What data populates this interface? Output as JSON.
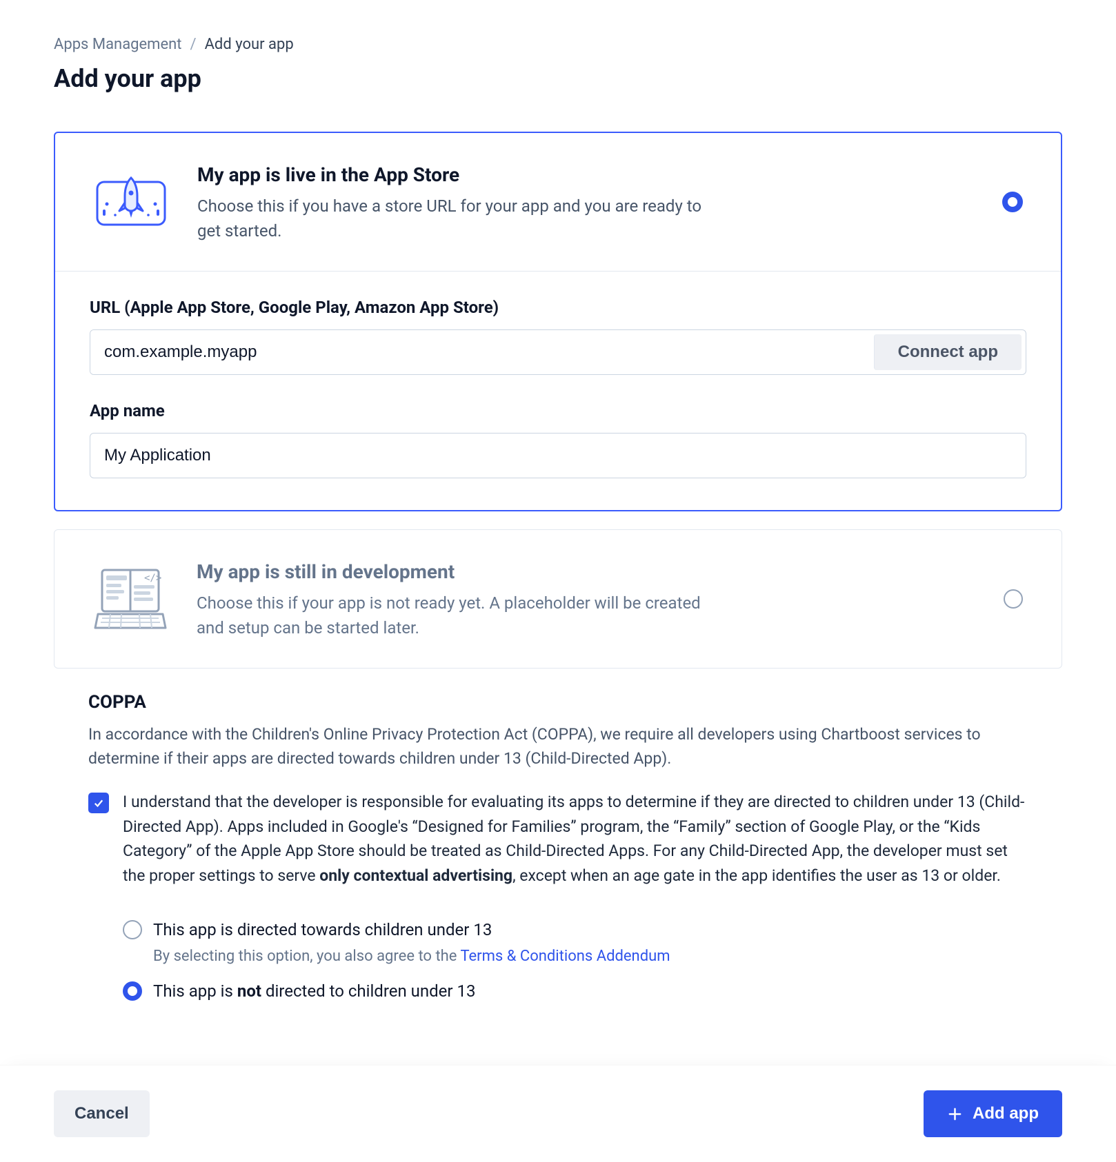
{
  "breadcrumb": {
    "parent": "Apps Management",
    "current": "Add your app"
  },
  "page_title": "Add your app",
  "option_live": {
    "title": "My app is live in the App Store",
    "description": "Choose this if you have a store URL for your app and you are ready to get started.",
    "selected": true,
    "url_label": "URL (Apple App Store, Google Play, Amazon App Store)",
    "url_value": "com.example.myapp",
    "connect_label": "Connect app",
    "name_label": "App name",
    "name_value": "My Application"
  },
  "option_dev": {
    "title": "My app is still in development",
    "description": "Choose this if your app is not ready yet. A placeholder will be created and setup can be started later.",
    "selected": false
  },
  "coppa": {
    "heading": "COPPA",
    "intro": "In accordance with the Children's Online Privacy Protection Act (COPPA), we require all developers using Chartboost services to determine if their apps are directed towards children under 13 (Child-Directed App).",
    "ack_pre": "I understand that the developer is responsible for evaluating its apps to determine if they are directed to children under 13 (Child-Directed App). Apps included in Google's “Designed for Families” program, the “Family” section of Google Play, or the “Kids Category” of the Apple App Store should be treated as Child-Directed Apps. For any Child-Directed App, the developer must set the proper settings to serve ",
    "ack_bold": "only contextual advertising",
    "ack_post": ", except when an age gate in the app identifies the user as 13 or older.",
    "ack_checked": true,
    "option_directed": {
      "label": "This app is directed towards children under 13",
      "sub_pre": "By selecting this option, you also agree to the ",
      "sub_link": "Terms & Conditions Addendum",
      "selected": false
    },
    "option_not_directed": {
      "pre": "This app is ",
      "bold": "not",
      "post": " directed to children under 13",
      "selected": true
    }
  },
  "footer": {
    "cancel": "Cancel",
    "add": "Add app"
  }
}
